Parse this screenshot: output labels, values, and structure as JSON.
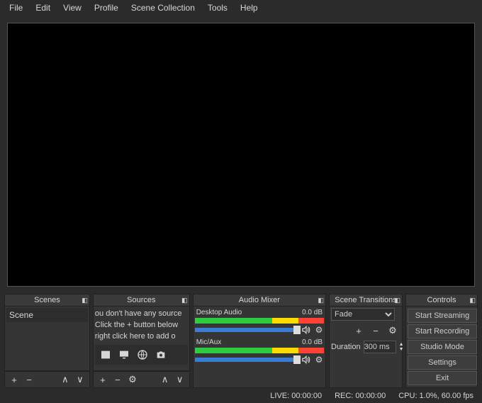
{
  "menu": [
    "File",
    "Edit",
    "View",
    "Profile",
    "Scene Collection",
    "Tools",
    "Help"
  ],
  "panels": {
    "scenes": "Scenes",
    "sources": "Sources",
    "mixer": "Audio Mixer",
    "transitions": "Scene Transitions",
    "controls": "Controls"
  },
  "scenes": {
    "items": [
      "Scene"
    ]
  },
  "sources": {
    "hint1": "ou don't have any source",
    "hint2": "Click the + button below",
    "hint3": "right click here to add o"
  },
  "mixer": {
    "ch": [
      {
        "name": "Desktop Audio",
        "level": "0.0 dB"
      },
      {
        "name": "Mic/Aux",
        "level": "0.0 dB"
      }
    ]
  },
  "transitions": {
    "selected": "Fade",
    "duration_label": "Duration",
    "duration_value": "300 ms"
  },
  "controls": {
    "stream": "Start Streaming",
    "record": "Start Recording",
    "studio": "Studio Mode",
    "settings": "Settings",
    "exit": "Exit"
  },
  "status": {
    "live": "LIVE: 00:00:00",
    "rec": "REC: 00:00:00",
    "cpu": "CPU: 1.0%, 60.00 fps"
  },
  "glyph": {
    "plus": "+",
    "minus": "−",
    "up": "∧",
    "down": "∨",
    "gear": "⚙",
    "updown": "⇅"
  }
}
